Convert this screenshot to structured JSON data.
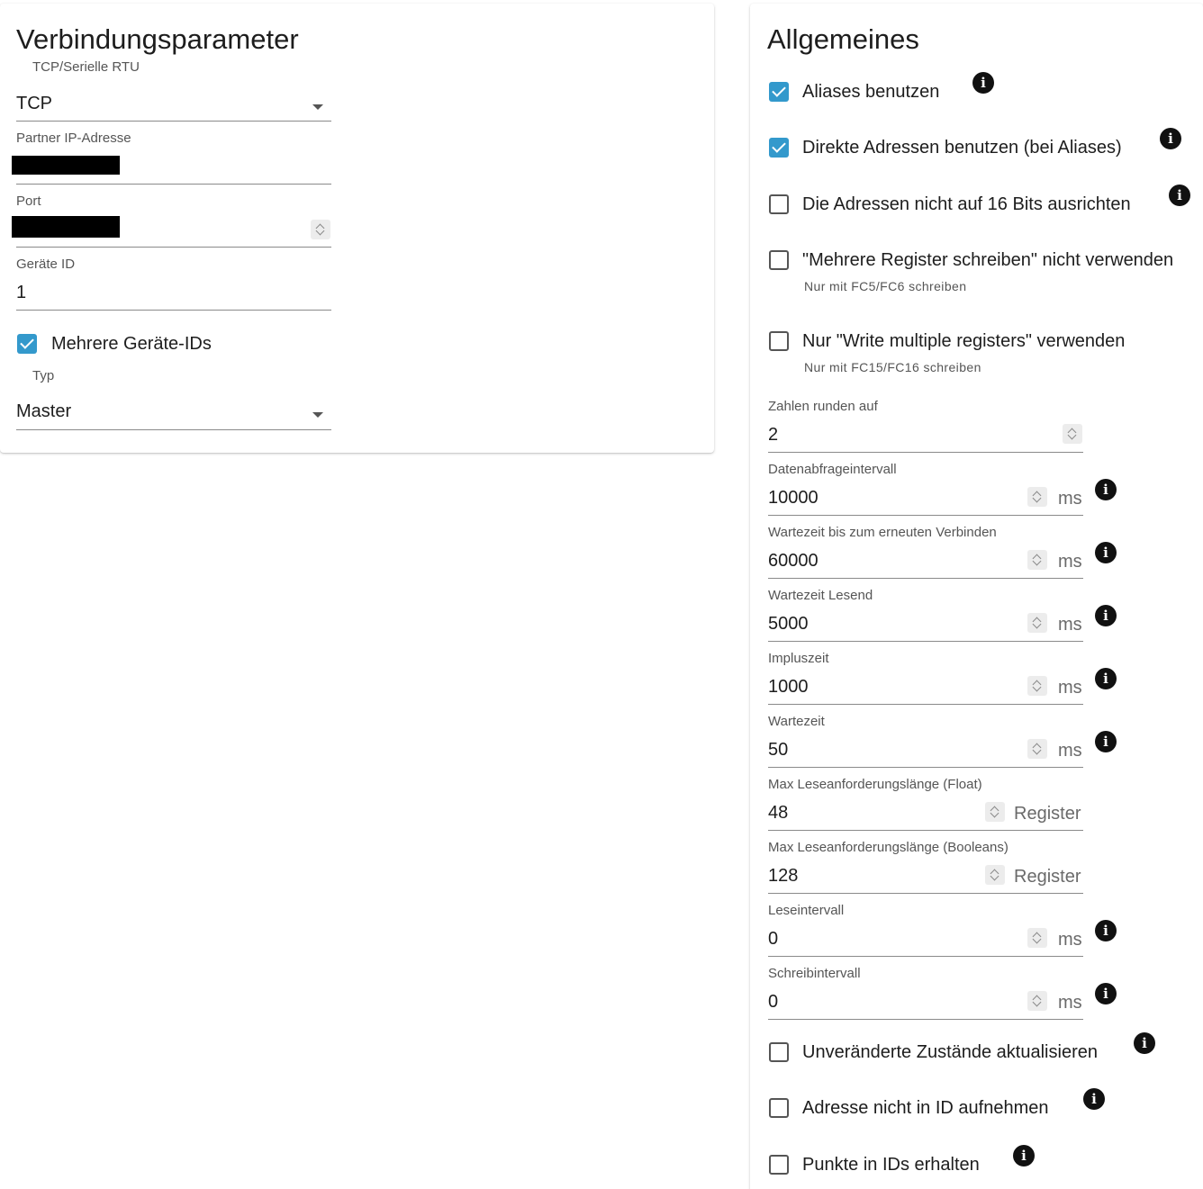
{
  "left_card": {
    "title": "Verbindungsparameter",
    "connection_type": {
      "label": "TCP/Serielle RTU",
      "value": "TCP"
    },
    "partner_ip": {
      "label": "Partner IP-Adresse",
      "value": ""
    },
    "port": {
      "label": "Port",
      "value": ""
    },
    "device_id": {
      "label": "Geräte ID",
      "value": "1"
    },
    "multi_device_ids": {
      "label": "Mehrere Geräte-IDs",
      "checked": true
    },
    "type": {
      "label": "Typ",
      "value": "Master"
    }
  },
  "right_card": {
    "title": "Allgemeines",
    "top_checkboxes": [
      {
        "label": "Aliases benutzen",
        "checked": true
      },
      {
        "label": "Direkte Adressen benutzen (bei Aliases)",
        "checked": true
      },
      {
        "label": "Die Adressen nicht auf 16 Bits ausrichten",
        "checked": false
      },
      {
        "label": "\"Mehrere Register schreiben\" nicht verwenden",
        "sub": "Nur mit FC5/FC6 schreiben",
        "checked": false
      },
      {
        "label": "Nur \"Write multiple registers\" verwenden",
        "sub": "Nur mit FC15/FC16 schreiben",
        "checked": false
      }
    ],
    "fields": [
      {
        "label": "Zahlen runden auf",
        "value": "2",
        "unit": ""
      },
      {
        "label": "Datenabfrageintervall",
        "value": "10000",
        "unit": "ms"
      },
      {
        "label": "Wartezeit bis zum erneuten Verbinden",
        "value": "60000",
        "unit": "ms"
      },
      {
        "label": "Wartezeit Lesend",
        "value": "5000",
        "unit": "ms"
      },
      {
        "label": "Impluszeit",
        "value": "1000",
        "unit": "ms"
      },
      {
        "label": "Wartezeit",
        "value": "50",
        "unit": "ms"
      },
      {
        "label": "Max Leseanforderungslänge (Float)",
        "value": "48",
        "unit": "Register"
      },
      {
        "label": "Max Leseanforderungslänge (Booleans)",
        "value": "128",
        "unit": "Register"
      },
      {
        "label": "Leseintervall",
        "value": "0",
        "unit": "ms"
      },
      {
        "label": "Schreibintervall",
        "value": "0",
        "unit": "ms"
      }
    ],
    "bottom_checkboxes": [
      {
        "label": "Unveränderte Zustände aktualisieren",
        "checked": false
      },
      {
        "label": "Adresse nicht in ID aufnehmen",
        "checked": false
      },
      {
        "label": "Punkte in IDs erhalten",
        "checked": false
      }
    ],
    "info_glyph": "i"
  },
  "colors": {
    "accent": "#3399cc",
    "text": "#1d1d1d",
    "muted": "#555555"
  }
}
